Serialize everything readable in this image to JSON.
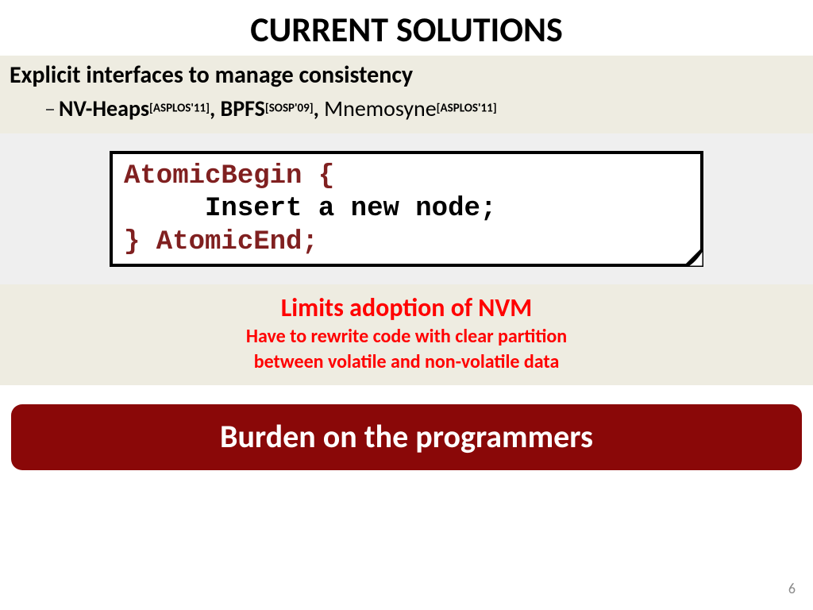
{
  "title": "CURRENT SOLUTIONS",
  "header": "Explicit interfaces to manage consistency",
  "items": [
    {
      "name": "NV-Heaps",
      "cite": "[ASPLOS'11]",
      "bold": true
    },
    {
      "name": "BPFS",
      "cite": "[SOSP'09]",
      "bold": true
    },
    {
      "name": "Mnemosyne",
      "cite": "[ASPLOS'11]",
      "bold": false
    }
  ],
  "code": {
    "line1_kw": "AtomicBegin {",
    "line2_indent": "     ",
    "line2_body": "Insert a new node;",
    "line3_kw": "} AtomicEnd;"
  },
  "limits": {
    "title": "Limits adoption of NVM",
    "sub1": "Have to rewrite code with clear partition",
    "sub2": "between volatile and non-volatile data"
  },
  "burden": "Burden on the programmers",
  "page": "6",
  "sep": ", ",
  "dash": "–"
}
